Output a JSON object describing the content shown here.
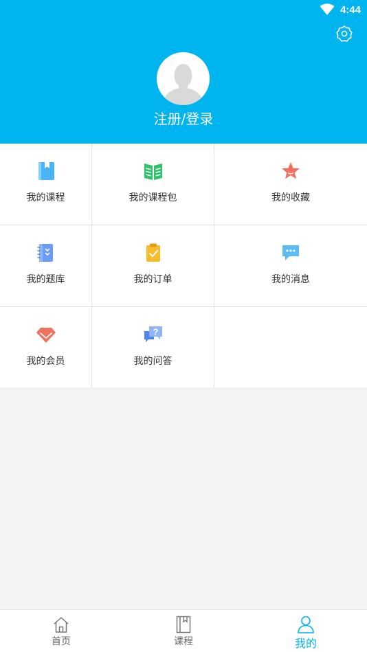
{
  "status_bar": {
    "time": "4:44",
    "wifi_icon": "wifi-icon"
  },
  "header": {
    "background": "#00b4ef",
    "settings_icon": "gear-icon",
    "avatar_icon": "default-avatar-icon",
    "login_label": "注册/登录"
  },
  "menu": {
    "items": [
      {
        "label": "我的课程",
        "icon": "course-book-icon",
        "color": "#4bb4f5"
      },
      {
        "label": "我的课程包",
        "icon": "course-package-icon",
        "color": "#2ec36b"
      },
      {
        "label": "我的收藏",
        "icon": "star-icon",
        "color": "#f2705e"
      },
      {
        "label": "我的题库",
        "icon": "question-bank-icon",
        "color": "#6a9cf6"
      },
      {
        "label": "我的订单",
        "icon": "order-clipboard-icon",
        "color": "#f8bb2c"
      },
      {
        "label": "我的消息",
        "icon": "message-bubble-icon",
        "color": "#5bbcf5"
      },
      {
        "label": "我的会员",
        "icon": "diamond-icon",
        "color": "#f2705e"
      },
      {
        "label": "我的问答",
        "icon": "qa-bubble-icon",
        "color": "#7aa6f5"
      }
    ]
  },
  "tabbar": {
    "active_color": "#00b4ef",
    "tabs": [
      {
        "label": "首页",
        "icon": "home-icon",
        "active": false
      },
      {
        "label": "课程",
        "icon": "book-icon",
        "active": false
      },
      {
        "label": "我的",
        "icon": "user-icon",
        "active": true
      }
    ]
  }
}
